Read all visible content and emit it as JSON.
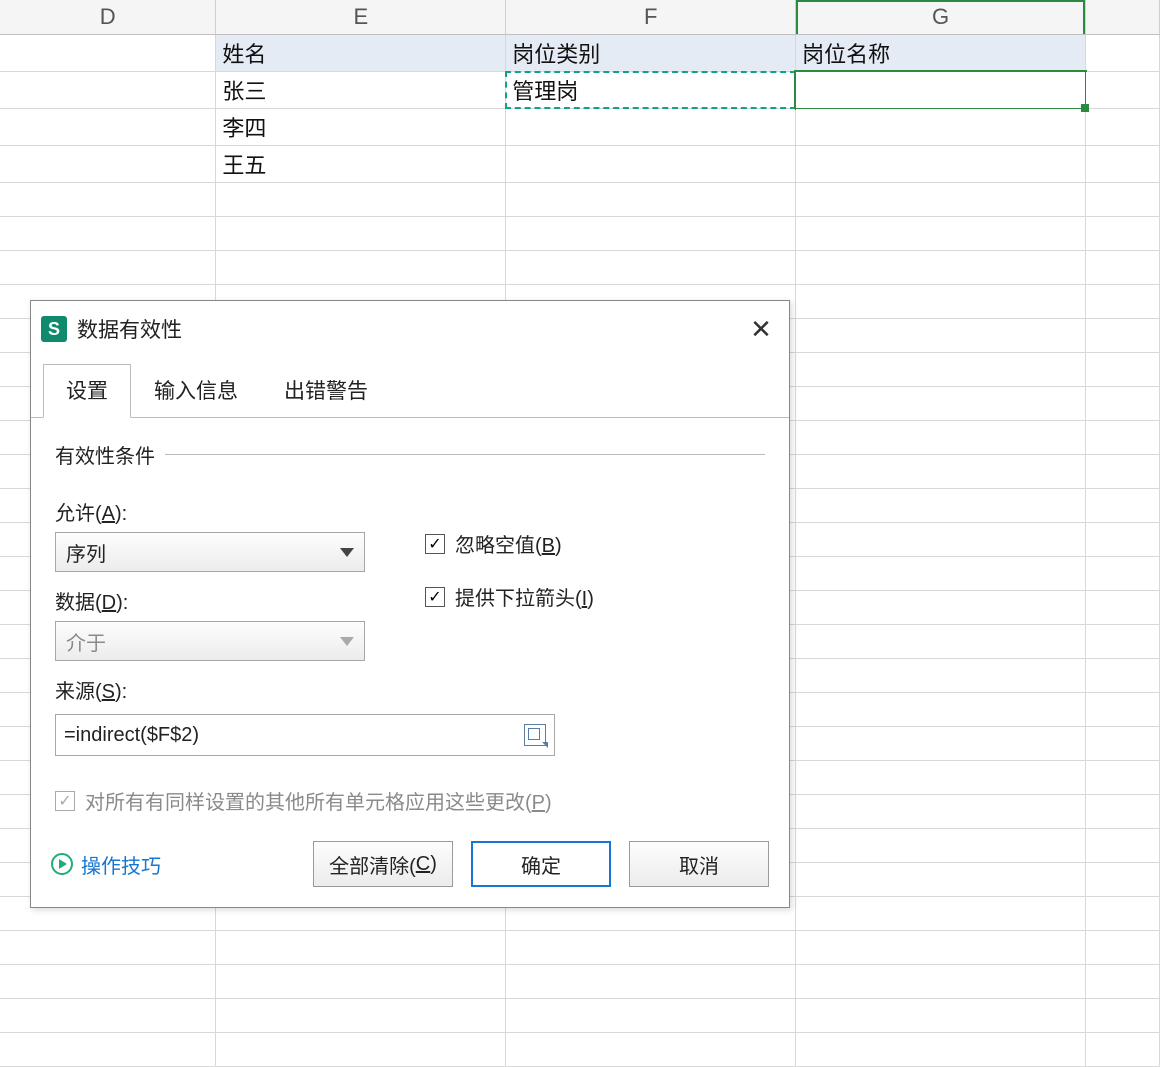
{
  "columns": [
    "D",
    "E",
    "F",
    "G"
  ],
  "grid": {
    "headers": {
      "E": "姓名",
      "F": "岗位类别",
      "G": "岗位名称"
    },
    "rows": [
      {
        "E": "张三",
        "F": "管理岗",
        "G": ""
      },
      {
        "E": "李四",
        "F": "",
        "G": ""
      },
      {
        "E": "王五",
        "F": "",
        "G": ""
      }
    ]
  },
  "dialog": {
    "title": "数据有效性",
    "tabs": {
      "settings": "设置",
      "input": "输入信息",
      "error": "出错警告"
    },
    "section": "有效性条件",
    "allow_label": "允许(A):",
    "allow_value": "序列",
    "data_label": "数据(D):",
    "data_value": "介于",
    "source_label": "来源(S):",
    "source_value": "=indirect($F$2)",
    "ignore_blank": "忽略空值(B)",
    "dropdown_arrow": "提供下拉箭头(I)",
    "apply_all": "对所有有同样设置的其他所有单元格应用这些更改(P)",
    "tips": "操作技巧",
    "clear": "全部清除(C)",
    "ok": "确定",
    "cancel": "取消"
  }
}
